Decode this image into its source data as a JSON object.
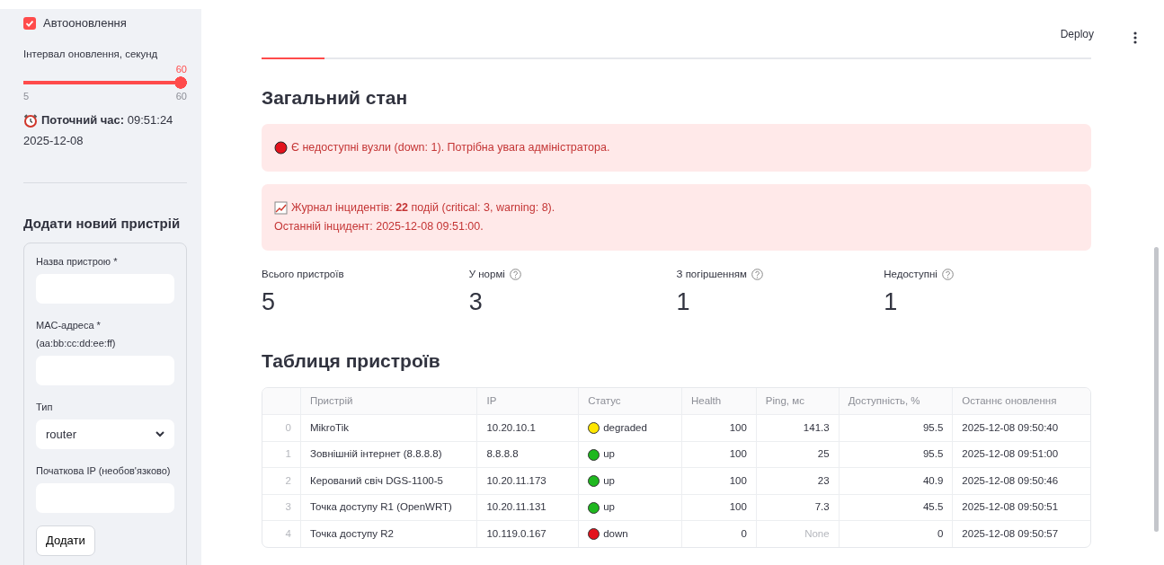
{
  "sidebar": {
    "auto_refresh": {
      "label": "Автооновлення",
      "checked": true
    },
    "interval": {
      "label": "Інтервал оновлення, секунд",
      "value": "60",
      "min": "5",
      "max": "60",
      "level": 1
    },
    "clock": {
      "label": "Поточний час:",
      "time": "09:51:24",
      "date": "2025-12-08"
    },
    "add_device": {
      "title": "Додати новий пристрій",
      "fields": [
        {
          "kind": "text",
          "label": "Назва пристрою *"
        },
        {
          "kind": "text",
          "label": "MAC-адреса * (aa:bb:cc:dd:ee:ff)"
        },
        {
          "kind": "select",
          "label": "Тип",
          "value": "router"
        },
        {
          "kind": "text",
          "label": "Початкова IP (необов'язково)"
        }
      ],
      "button": "Додати"
    }
  },
  "header": {
    "deploy": "Deploy"
  },
  "overview": {
    "title": "Загальний стан",
    "alerts": [
      {
        "kind": "down",
        "lines": [
          "Є недоступні вузли (down: 1). Потрібна увага адміністратора."
        ]
      },
      {
        "kind": "log",
        "lines": [
          "Журнал інцидентів: **22** подій (critical: 3, warning: 8).",
          "Останній інцидент: 2025-12-08 09:51:00."
        ]
      }
    ],
    "metrics": [
      {
        "label": "Всього пристроїв",
        "value": "5",
        "help": false
      },
      {
        "label": "У нормі",
        "value": "3",
        "help": true
      },
      {
        "label": "З погіршенням",
        "value": "1",
        "help": true
      },
      {
        "label": "Недоступні",
        "value": "1",
        "help": true
      }
    ]
  },
  "devices": {
    "title": "Таблиця пристроїв",
    "columns": [
      "Пристрій",
      "IP",
      "Статус",
      "Health",
      "Ping, мс",
      "Доступність, %",
      "Останнє оновлення"
    ],
    "rows": [
      {
        "index": "0",
        "device": "MikroTik",
        "ip": "10.20.10.1",
        "status": "degraded",
        "color": "#ffe600",
        "health": "100",
        "ping": "141.3",
        "ping_missing": false,
        "availability": "95.5",
        "updated": "2025-12-08 09:50:40"
      },
      {
        "index": "1",
        "device": "Зовнішній інтернет (8.8.8.8)",
        "ip": "8.8.8.8",
        "status": "up",
        "color": "#1fb81f",
        "health": "100",
        "ping": "25",
        "ping_missing": false,
        "availability": "95.5",
        "updated": "2025-12-08 09:51:00"
      },
      {
        "index": "2",
        "device": "Керований свіч DGS-1100-5",
        "ip": "10.20.11.173",
        "status": "up",
        "color": "#1fb81f",
        "health": "100",
        "ping": "23",
        "ping_missing": false,
        "availability": "40.9",
        "updated": "2025-12-08 09:50:46"
      },
      {
        "index": "3",
        "device": "Точка доступу R1 (OpenWRT)",
        "ip": "10.20.11.131",
        "status": "up",
        "color": "#1fb81f",
        "health": "100",
        "ping": "7.3",
        "ping_missing": false,
        "availability": "45.5",
        "updated": "2025-12-08 09:50:51"
      },
      {
        "index": "4",
        "device": "Точка доступу R2",
        "ip": "10.119.0.167",
        "status": "down",
        "color": "#e3121c",
        "health": "0",
        "ping": "None",
        "ping_missing": true,
        "availability": "0",
        "updated": "2025-12-08 09:50:57"
      }
    ]
  }
}
